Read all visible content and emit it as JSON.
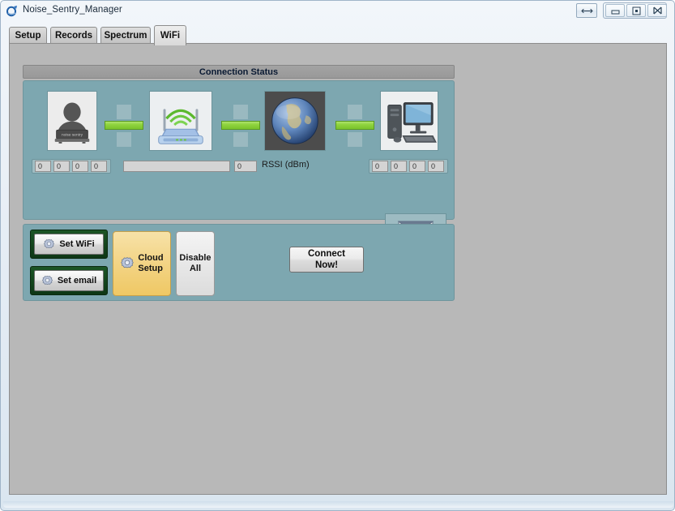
{
  "window": {
    "title": "Noise_Sentry_Manager",
    "app_icon": "app-logo-icon",
    "buttons": {
      "resize": "resize-arrows-icon",
      "minimize": "minimize-icon",
      "maximize": "maximize-icon",
      "close": "close-icon"
    }
  },
  "tabs": [
    {
      "label": "Setup",
      "active": false
    },
    {
      "label": "Records",
      "active": false
    },
    {
      "label": "Spectrum",
      "active": false
    },
    {
      "label": "WiFi",
      "active": true
    }
  ],
  "connection": {
    "header": "Connection Status",
    "nodes": [
      {
        "name": "sensor-device",
        "icon": "noise-sentry-device-icon",
        "caption": "noise sentry"
      },
      {
        "name": "wifi-router",
        "icon": "wifi-router-icon"
      },
      {
        "name": "internet-globe",
        "icon": "globe-earth-icon"
      },
      {
        "name": "computer",
        "icon": "desktop-computer-icon"
      }
    ],
    "links": [
      {
        "name": "link-sensor-router",
        "state": "active"
      },
      {
        "name": "link-router-internet",
        "state": "active"
      },
      {
        "name": "link-internet-pc",
        "state": "active"
      }
    ],
    "sensor_ip": [
      "0",
      "0",
      "0",
      "0"
    ],
    "ssid_value": "",
    "ssid_placeholder": "",
    "rssi_value": "0",
    "rssi_label": "RSSI (dBm)",
    "host_ip": [
      "0",
      "0",
      "0",
      "0"
    ],
    "email_icon": "email-envelope-icon"
  },
  "controls": {
    "set_wifi": {
      "label": "Set WiFi",
      "icon": "gear-icon"
    },
    "set_email": {
      "label": "Set email",
      "icon": "gear-icon"
    },
    "cloud_setup": {
      "line1": "Cloud",
      "line2": "Setup",
      "icon": "gear-icon"
    },
    "disable_all": {
      "line1": "Disable",
      "line2": "All"
    },
    "connect_now": {
      "line1": "Connect",
      "line2": "Now!"
    }
  },
  "colors": {
    "panel_teal": "#7da7b0",
    "window_gray": "#b8b8b8",
    "link_green": "#8fd33e",
    "cloud_orange": "#f3d588",
    "frame_green": "#0d3715"
  }
}
